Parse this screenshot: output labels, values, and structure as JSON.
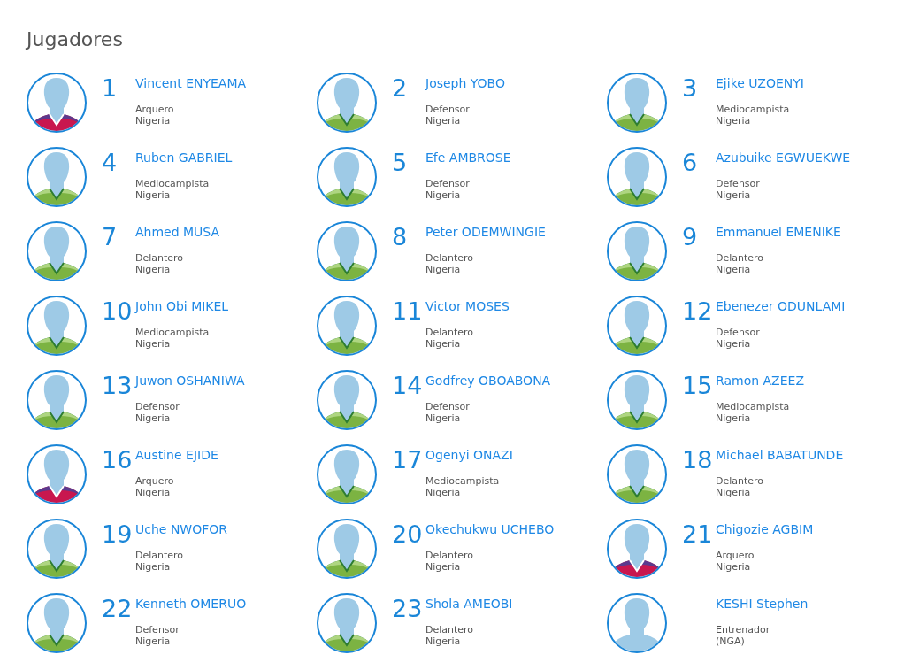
{
  "section": {
    "title": "Jugadores"
  },
  "players": [
    {
      "number": "1",
      "name": "Vincent ENYEAMA",
      "role": "Arquero",
      "country": "Nigeria",
      "kind": "goalkeeper"
    },
    {
      "number": "2",
      "name": "Joseph YOBO",
      "role": "Defensor",
      "country": "Nigeria",
      "kind": "field"
    },
    {
      "number": "3",
      "name": "Ejike UZOENYI",
      "role": "Mediocampista",
      "country": "Nigeria",
      "kind": "field"
    },
    {
      "number": "4",
      "name": "Ruben GABRIEL",
      "role": "Mediocampista",
      "country": "Nigeria",
      "kind": "field"
    },
    {
      "number": "5",
      "name": "Efe AMBROSE",
      "role": "Defensor",
      "country": "Nigeria",
      "kind": "field"
    },
    {
      "number": "6",
      "name": "Azubuike EGWUEKWE",
      "role": "Defensor",
      "country": "Nigeria",
      "kind": "field"
    },
    {
      "number": "7",
      "name": "Ahmed MUSA",
      "role": "Delantero",
      "country": "Nigeria",
      "kind": "field"
    },
    {
      "number": "8",
      "name": "Peter ODEMWINGIE",
      "role": "Delantero",
      "country": "Nigeria",
      "kind": "field"
    },
    {
      "number": "9",
      "name": "Emmanuel EMENIKE",
      "role": "Delantero",
      "country": "Nigeria",
      "kind": "field"
    },
    {
      "number": "10",
      "name": "John Obi MIKEL",
      "role": "Mediocampista",
      "country": "Nigeria",
      "kind": "field"
    },
    {
      "number": "11",
      "name": "Victor MOSES",
      "role": "Delantero",
      "country": "Nigeria",
      "kind": "field"
    },
    {
      "number": "12",
      "name": "Ebenezer ODUNLAMI",
      "role": "Defensor",
      "country": "Nigeria",
      "kind": "field"
    },
    {
      "number": "13",
      "name": "Juwon OSHANIWA",
      "role": "Defensor",
      "country": "Nigeria",
      "kind": "field"
    },
    {
      "number": "14",
      "name": "Godfrey OBOABONA",
      "role": "Defensor",
      "country": "Nigeria",
      "kind": "field"
    },
    {
      "number": "15",
      "name": "Ramon AZEEZ",
      "role": "Mediocampista",
      "country": "Nigeria",
      "kind": "field"
    },
    {
      "number": "16",
      "name": "Austine EJIDE",
      "role": "Arquero",
      "country": "Nigeria",
      "kind": "goalkeeper"
    },
    {
      "number": "17",
      "name": "Ogenyi ONAZI",
      "role": "Mediocampista",
      "country": "Nigeria",
      "kind": "field"
    },
    {
      "number": "18",
      "name": "Michael BABATUNDE",
      "role": "Delantero",
      "country": "Nigeria",
      "kind": "field"
    },
    {
      "number": "19",
      "name": "Uche NWOFOR",
      "role": "Delantero",
      "country": "Nigeria",
      "kind": "field"
    },
    {
      "number": "20",
      "name": "Okechukwu UCHEBO",
      "role": "Delantero",
      "country": "Nigeria",
      "kind": "field"
    },
    {
      "number": "21",
      "name": "Chigozie AGBIM",
      "role": "Arquero",
      "country": "Nigeria",
      "kind": "goalkeeper"
    },
    {
      "number": "22",
      "name": "Kenneth OMERUO",
      "role": "Defensor",
      "country": "Nigeria",
      "kind": "field"
    },
    {
      "number": "23",
      "name": "Shola AMEOBI",
      "role": "Delantero",
      "country": "Nigeria",
      "kind": "field"
    },
    {
      "name": "KESHI Stephen",
      "role": "Entrenador",
      "country": "(NGA)",
      "kind": "coach"
    }
  ]
}
